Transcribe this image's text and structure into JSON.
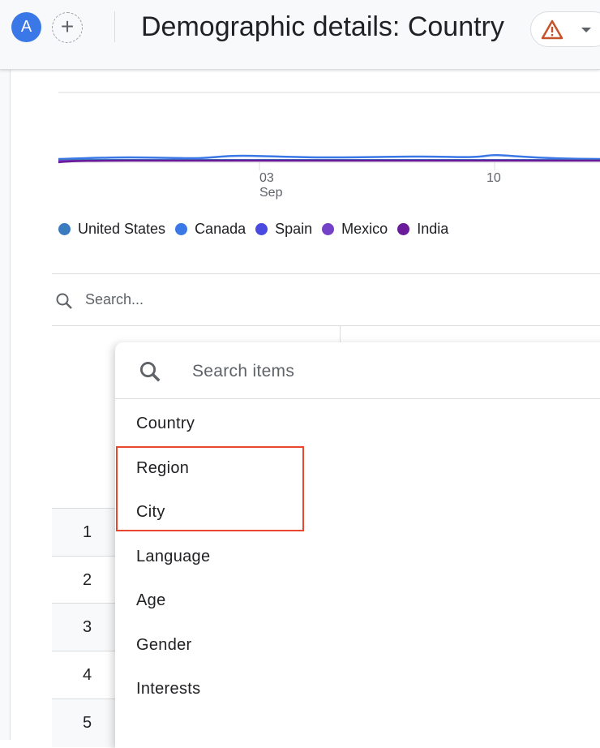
{
  "header": {
    "avatar_letter": "A",
    "add_icon": "plus-icon",
    "title": "Demographic details: Country",
    "warning_icon": "warning-triangle-icon",
    "warning_color": "#c5522a"
  },
  "chart_data": {
    "type": "line",
    "x_ticks": [
      {
        "day": "03",
        "month": "Sep"
      },
      {
        "day": "10",
        "month": ""
      }
    ],
    "legend": [
      {
        "name": "United States",
        "color": "#3a7bbf"
      },
      {
        "name": "Canada",
        "color": "#3b78e7"
      },
      {
        "name": "Spain",
        "color": "#4a4ae0"
      },
      {
        "name": "Mexico",
        "color": "#7342c8"
      },
      {
        "name": "India",
        "color": "#6a1b9a"
      }
    ],
    "grid": true
  },
  "table": {
    "search_placeholder": "Search...",
    "row_numbers": [
      "1",
      "2",
      "3",
      "4",
      "5"
    ]
  },
  "dropdown": {
    "search_placeholder": "Search items",
    "items": [
      "Country",
      "Region",
      "City",
      "Language",
      "Age",
      "Gender",
      "Interests"
    ],
    "highlighted": [
      "Region",
      "City"
    ],
    "highlight_color": "#e8472d"
  }
}
